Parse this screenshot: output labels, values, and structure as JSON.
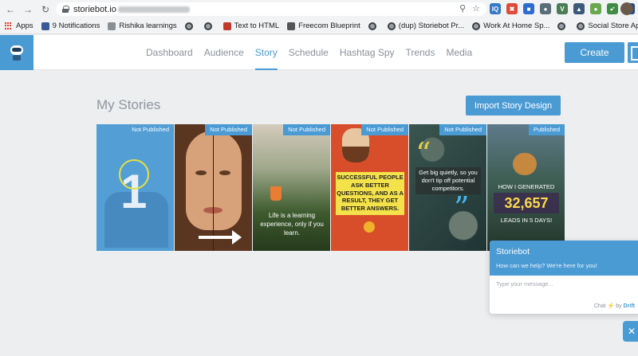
{
  "browser": {
    "url": "storiebot.io"
  },
  "bookmarks": [
    {
      "label": "Apps"
    },
    {
      "label": "9 Notifications"
    },
    {
      "label": "Rishika learnings"
    },
    {
      "label": ""
    },
    {
      "label": ""
    },
    {
      "label": "Text to HTML"
    },
    {
      "label": "Freecom Blueprint"
    },
    {
      "label": ""
    },
    {
      "label": "(dup) Storiebot Pr..."
    },
    {
      "label": "Work At Home Sp..."
    },
    {
      "label": ""
    },
    {
      "label": "Social Store App"
    }
  ],
  "nav": {
    "items": [
      {
        "label": "Dashboard"
      },
      {
        "label": "Audience"
      },
      {
        "label": "Story"
      },
      {
        "label": "Schedule"
      },
      {
        "label": "Hashtag Spy"
      },
      {
        "label": "Trends"
      },
      {
        "label": "Media"
      }
    ],
    "active": "Story",
    "create_label": "Create"
  },
  "page": {
    "title": "My Stories",
    "import_label": "Import Story Design"
  },
  "stories": [
    {
      "status": "Not Published",
      "big_text": "1"
    },
    {
      "status": "Not Published"
    },
    {
      "status": "Not Published",
      "text": "Life is a learning experience, only if you learn."
    },
    {
      "status": "Not Published",
      "text": "SUCCESSFUL PEOPLE ASK BETTER QUESTIONS, AND AS A RESULT, THEY GET BETTER ANSWERS."
    },
    {
      "status": "Not Published",
      "text": "Get big quietly, so you don't tip off potential competitors."
    },
    {
      "status": "Published",
      "line1": "HOW I GENERATED",
      "number": "32,657",
      "line2": "LEADS IN 5 DAYS!"
    }
  ],
  "chat": {
    "title": "Storiebot",
    "subtitle": "How can we help? We're here for you!",
    "placeholder": "Type your message...",
    "footer_prefix": "Chat",
    "footer_by": "by",
    "footer_brand": "Drift"
  },
  "colors": {
    "accent": "#4a9ad4",
    "background": "#eceef0"
  }
}
